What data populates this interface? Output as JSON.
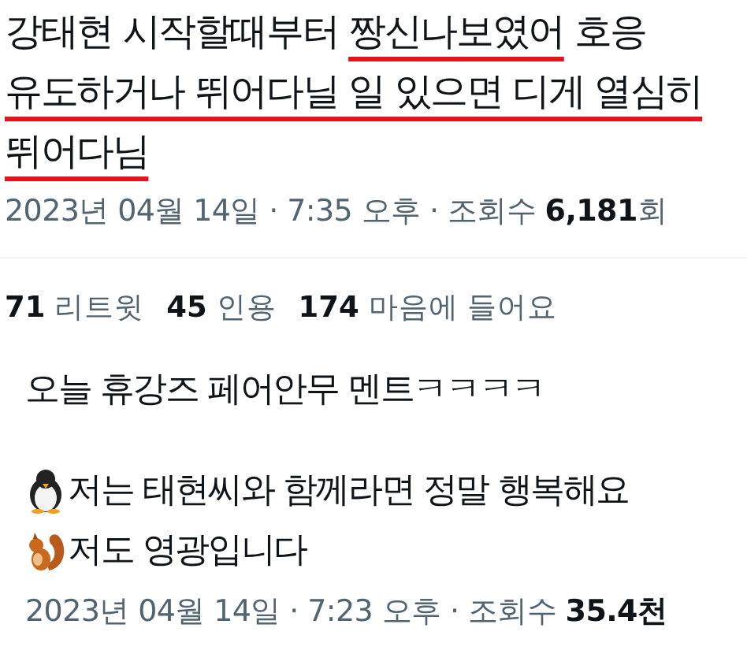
{
  "tweets": [
    {
      "kind": "main",
      "paragraphs": [
        [
          [
            {
              "text": "강태현 시작할때부터 ",
              "underlined": false
            },
            {
              "text": "짱신나보였어",
              "underlined": true
            },
            {
              "text": " 호응",
              "underlined": false
            }
          ],
          [
            {
              "text": "유도하거나 뛰어다닐 일 있으면 디게 열심히",
              "underlined": true
            }
          ],
          [
            {
              "text": "뛰어다님",
              "underlined": true
            }
          ]
        ]
      ],
      "timestamp": "2023년 04월 14일 · 7:35 오후 · 조회수 **6,181**회",
      "stats": [
        "**71** 리트윗",
        "**45** 인용",
        "**174** 마음에 들어요"
      ]
    },
    {
      "kind": "quoted",
      "paragraphs": [
        [
          [
            {
              "text": "오늘 휴강즈 페어안무 멘트ㅋㅋㅋㅋ",
              "underlined": false
            }
          ]
        ],
        [
          [
            {
              "kind": "penguin",
              "text": "저는 태현씨와 함께라면 정말 행복해요",
              "underlined": false
            }
          ],
          [
            {
              "kind": "squirrel",
              "text": "저도 영광입니다",
              "underlined": false
            }
          ]
        ]
      ],
      "timestamp": "2023년 04월 14일 · 7:23 오후 · 조회수 **35.4천**"
    }
  ]
}
